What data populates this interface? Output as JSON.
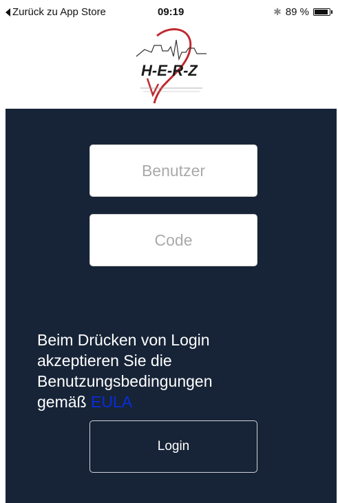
{
  "status_bar": {
    "back_label": "Zurück zu App Store",
    "time": "09:19",
    "bluetooth_icon": "bluetooth-icon",
    "battery_percent": "89 %",
    "battery_level": 0.89
  },
  "logo": {
    "text": "H-E-R-Z",
    "accent_color": "#c0282d"
  },
  "form": {
    "user_placeholder": "Benutzer",
    "code_placeholder": "Code"
  },
  "terms": {
    "text": "Beim Drücken von Login akzeptieren Sie die Benutzungsbedingungen gemäß ",
    "link": "EULA"
  },
  "login_button": "Login",
  "colors": {
    "panel_bg": "#172437",
    "link": "#0a2cdb"
  }
}
